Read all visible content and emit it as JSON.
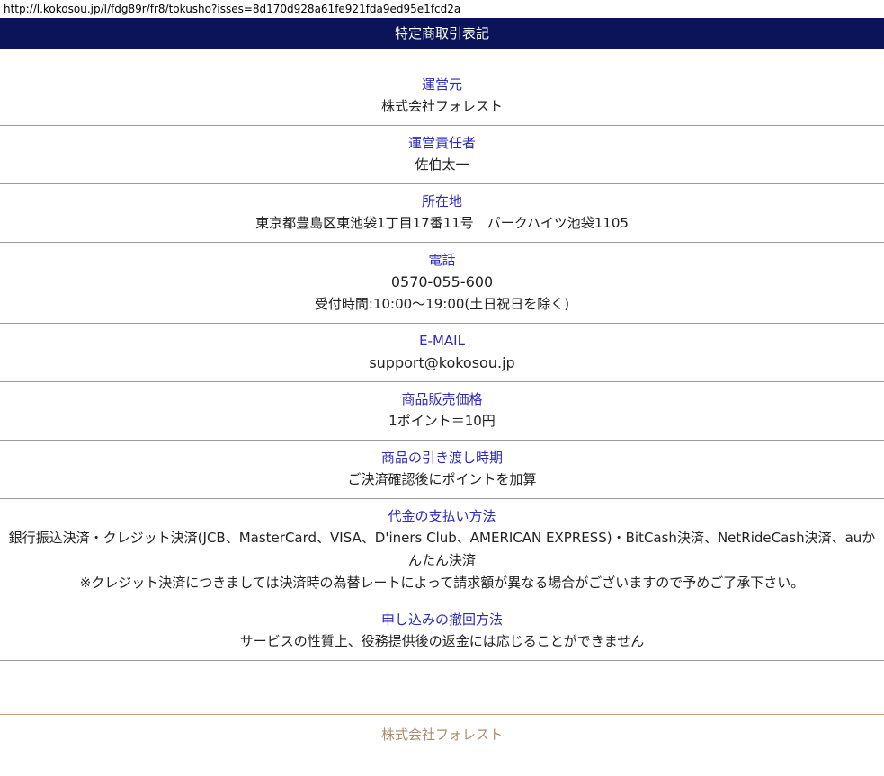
{
  "browser": {
    "url": "http://l.kokosou.jp/l/fdg89r/fr8/tokusho?isses=8d170d928a61fe921fda9ed95e1fcd2a"
  },
  "header": {
    "title": "特定商取引表記"
  },
  "sections": [
    {
      "label": "運営元",
      "lines": [
        "株式会社フォレスト"
      ]
    },
    {
      "label": "運営責任者",
      "lines": [
        "佐伯太一"
      ]
    },
    {
      "label": "所在地",
      "lines": [
        "東京都豊島区東池袋1丁目17番11号　パークハイツ池袋1105"
      ]
    },
    {
      "label": "電話",
      "lines": [
        "0570-055-600",
        "受付時間:10:00～19:00(土日祝日を除く)"
      ]
    },
    {
      "label": "E-MAIL",
      "lines": [
        "support@kokosou.jp"
      ]
    },
    {
      "label": "商品販売価格",
      "lines": [
        "1ポイント＝10円"
      ]
    },
    {
      "label": "商品の引き渡し時期",
      "lines": [
        "ご決済確認後にポイントを加算"
      ]
    },
    {
      "label": "代金の支払い方法",
      "lines": [
        "銀行振込決済・クレジット決済(JCB、MasterCard、VISA、D'iners Club、AMERICAN EXPRESS)・BitCash決済、NetRideCash決済、auかんたん決済",
        "※クレジット決済につきましては決済時の為替レートによって請求額が異なる場合がございますので予めご了承下さい。"
      ]
    },
    {
      "label": "申し込みの撤回方法",
      "lines": [
        "サービスの性質上、役務提供後の返金には応じることができません"
      ]
    }
  ],
  "footer": {
    "company": "株式会社フォレスト"
  }
}
